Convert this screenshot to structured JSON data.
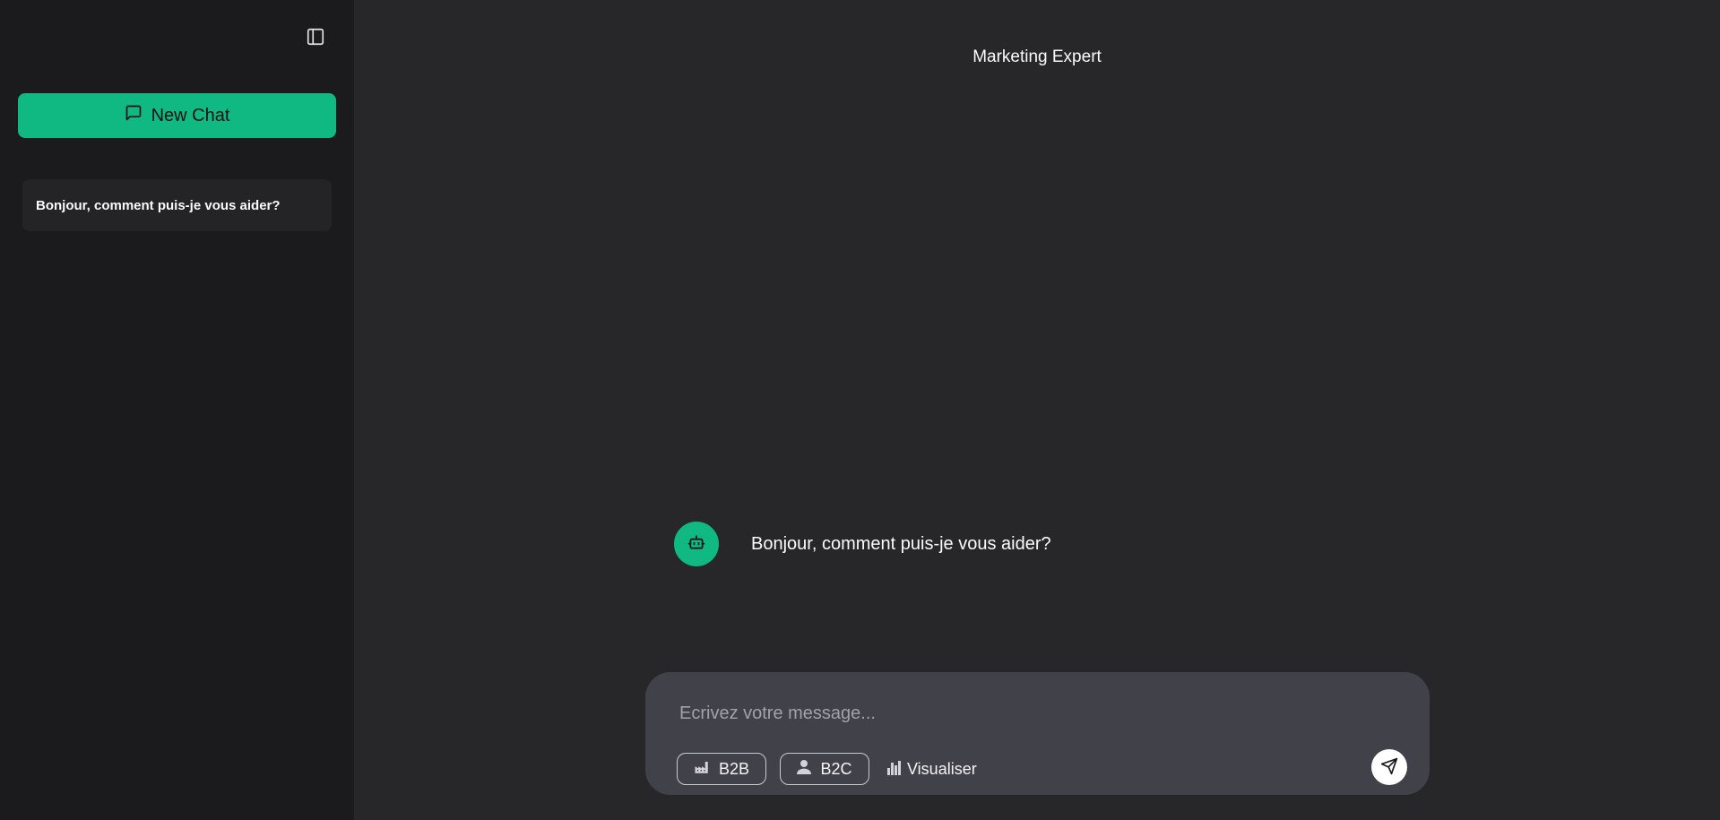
{
  "sidebar": {
    "toggle_icon": "sidebar-toggle-icon",
    "new_chat": {
      "label": "New Chat",
      "icon": "message-square-icon"
    },
    "history": [
      {
        "label": "Bonjour, comment puis-je vous aider?"
      }
    ]
  },
  "header": {
    "title": "Marketing Expert"
  },
  "conversation": {
    "messages": [
      {
        "role": "assistant",
        "avatar_icon": "bot-icon",
        "text": "Bonjour, comment puis-je vous aider?"
      }
    ]
  },
  "composer": {
    "placeholder": "Ecrivez votre message...",
    "value": "",
    "chips": [
      {
        "label": "B2B",
        "icon": "factory-icon"
      },
      {
        "label": "B2C",
        "icon": "user-icon"
      }
    ],
    "visualize": {
      "label": "Visualiser",
      "icon": "bar-chart-icon"
    },
    "send_icon": "send-icon"
  },
  "colors": {
    "accent": "#10b981",
    "sidebar_bg": "#1b1b1e",
    "main_bg": "#27272a",
    "composer_bg": "#414149",
    "history_item_bg": "#242427"
  }
}
